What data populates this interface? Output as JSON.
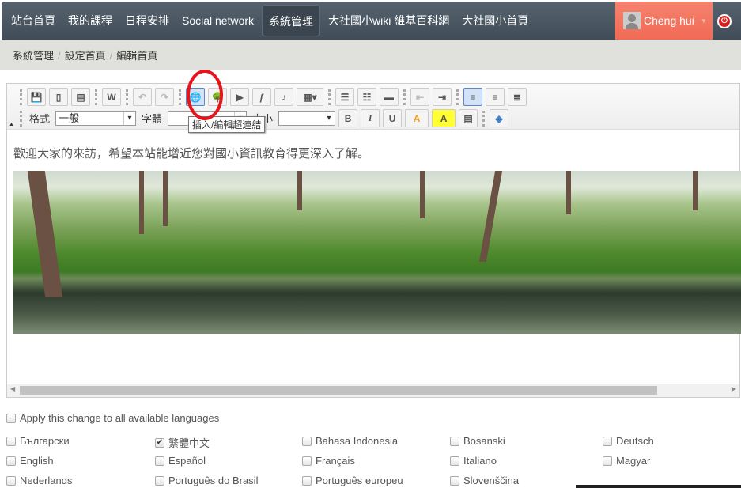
{
  "nav": {
    "items": [
      "站台首頁",
      "我的課程",
      "日程安排",
      "Social network",
      "系統管理",
      "大社國小wiki 維基百科網",
      "大社國小首頁"
    ],
    "active": 4,
    "user": "Cheng hui",
    "user_color": "#f26a55",
    "icons": {
      "user": "avatar",
      "logout": "power-icon"
    }
  },
  "breadcrumb": [
    "系統管理",
    "設定首頁",
    "編輯首頁"
  ],
  "toolbar": {
    "row1": [
      [
        "save-icon",
        ""
      ],
      [
        "new-page-icon",
        ""
      ],
      [
        "templates-icon",
        ""
      ],
      [
        "paste-word-icon",
        ""
      ],
      [
        "undo-icon",
        ""
      ],
      [
        "redo-icon",
        ""
      ],
      [
        "link-icon",
        ""
      ],
      [
        "image-icon",
        ""
      ],
      [
        "video-icon",
        ""
      ],
      [
        "flash-icon",
        ""
      ],
      [
        "audio-icon",
        ""
      ],
      [
        "table-icon",
        ""
      ],
      [
        "bulleted-list-icon",
        ""
      ],
      [
        "numbered-list-icon",
        ""
      ],
      [
        "horizontal-rule-icon",
        ""
      ],
      [
        "outdent-icon",
        ""
      ],
      [
        "indent-icon",
        ""
      ],
      [
        "align-left-icon",
        ""
      ],
      [
        "align-center-icon",
        ""
      ],
      [
        "justify-icon",
        ""
      ]
    ],
    "format_label": "格式",
    "format_value": "一般",
    "font_label": "字體",
    "font_value": "",
    "size_label": "大小",
    "size_value": "",
    "bold": "B",
    "italic": "I",
    "underline": "U",
    "text_color": "A",
    "bg_color": "A",
    "tooltip": "插入/編輯超連結"
  },
  "content": {
    "text": "歡迎大家的來訪，希望本站能增近您對國小資訊教育得更深入了解。"
  },
  "apply_all": "Apply this change to all available languages",
  "languages": [
    {
      "label": "Български",
      "checked": false
    },
    {
      "label": "繁體中文",
      "checked": true
    },
    {
      "label": "Bahasa Indonesia",
      "checked": false
    },
    {
      "label": "Bosanski",
      "checked": false
    },
    {
      "label": "Deutsch",
      "checked": false
    },
    {
      "label": "English",
      "checked": false
    },
    {
      "label": "Español",
      "checked": false
    },
    {
      "label": "Français",
      "checked": false
    },
    {
      "label": "Italiano",
      "checked": false
    },
    {
      "label": "Magyar",
      "checked": false
    },
    {
      "label": "Nederlands",
      "checked": false
    },
    {
      "label": "Português do Brasil",
      "checked": false
    },
    {
      "label": "Português europeu",
      "checked": false
    },
    {
      "label": "Slovenščina",
      "checked": false
    }
  ]
}
